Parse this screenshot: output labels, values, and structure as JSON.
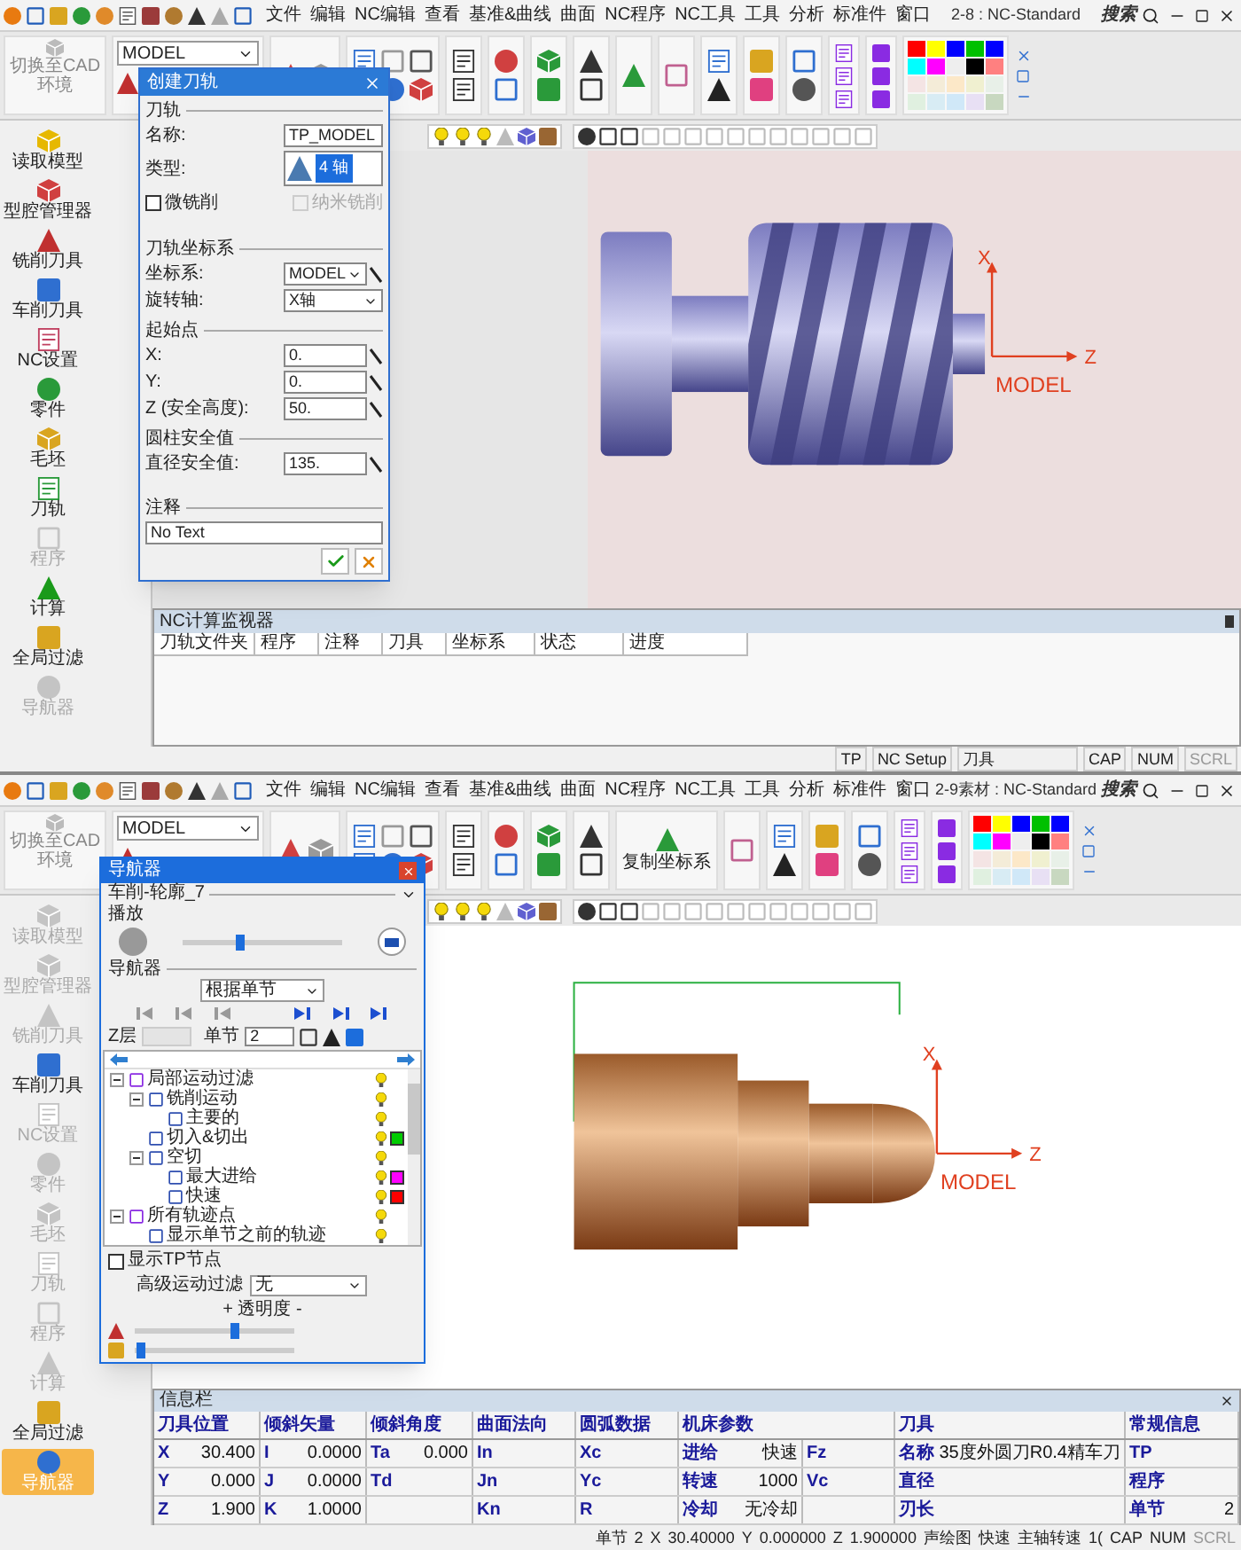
{
  "top_window": {
    "menu": [
      "文件",
      "编辑",
      "NC编辑",
      "查看",
      "基准&曲线",
      "曲面",
      "NC程序",
      "NC工具",
      "工具",
      "分析",
      "标准件",
      "窗口"
    ],
    "title": "2-8 : NC-Standard",
    "search": "搜索",
    "ribbon": {
      "cad_button": "切换至CAD环境",
      "model_select": "MODEL"
    },
    "sidebar": [
      {
        "label": "读取模型",
        "disabled": false,
        "selected": false
      },
      {
        "label": "型腔管理器",
        "disabled": false,
        "selected": false
      },
      {
        "label": "铣削刀具",
        "disabled": false,
        "selected": false
      },
      {
        "label": "车削刀具",
        "disabled": false,
        "selected": false
      },
      {
        "label": "NC设置",
        "disabled": false,
        "selected": false
      },
      {
        "label": "零件",
        "disabled": false,
        "selected": false
      },
      {
        "label": "毛坯",
        "disabled": false,
        "selected": false
      },
      {
        "label": "刀轨",
        "disabled": false,
        "selected": false
      },
      {
        "label": "程序",
        "disabled": true,
        "selected": false
      },
      {
        "label": "计算",
        "disabled": false,
        "selected": false
      },
      {
        "label": "全局过滤",
        "disabled": false,
        "selected": false
      },
      {
        "label": "导航器",
        "disabled": true,
        "selected": false
      }
    ],
    "dialog": {
      "title": "创建刀轨",
      "group": "刀轨",
      "name_label": "名称:",
      "name_value": "TP_MODEL",
      "type_label": "类型:",
      "type_value": "4 轴",
      "checkboxes": [
        {
          "label": "微铣削",
          "checked": false,
          "disabled": false
        },
        {
          "label": "纳米铣削",
          "checked": false,
          "disabled": true
        }
      ],
      "coord_group": "刀轨坐标系",
      "coord_label": "坐标系:",
      "coord_value": "MODEL",
      "axis_label": "旋转轴:",
      "axis_value": "X轴",
      "start_group": "起始点",
      "start_fields": [
        {
          "label": "X:",
          "value": "0."
        },
        {
          "label": "Y:",
          "value": "0."
        },
        {
          "label": "Z (安全高度):",
          "value": "50."
        }
      ],
      "cyl_group": "圆柱安全值",
      "dia_label": "直径安全值:",
      "dia_value": "135.",
      "comment_group": "注释",
      "comment_value": "No Text"
    },
    "viewport": {
      "axis_x": "X",
      "axis_z": "Z",
      "origin": "MODEL"
    },
    "monitor": {
      "title": "NC计算监视器",
      "columns": [
        "刀轨文件夹",
        "程序",
        "注释",
        "刀具",
        "坐标系",
        "状态",
        "进度"
      ]
    },
    "status_bar": [
      "TP",
      "NC Setup",
      "刀具",
      "CAP",
      "NUM",
      "SCRL"
    ]
  },
  "bottom_window": {
    "menu": [
      "文件",
      "编辑",
      "NC编辑",
      "查看",
      "基准&曲线",
      "曲面",
      "NC程序",
      "NC工具",
      "工具",
      "分析",
      "标准件",
      "窗口"
    ],
    "title": "2-9素材 : NC-Standard",
    "search": "搜索",
    "ribbon": {
      "cad_button": "切换至CAD环境",
      "model_select": "MODEL",
      "coord_label": "复制坐标系"
    },
    "sidebar": [
      {
        "label": "读取模型",
        "disabled": true,
        "selected": false
      },
      {
        "label": "型腔管理器",
        "disabled": true,
        "selected": false
      },
      {
        "label": "铣削刀具",
        "disabled": true,
        "selected": false
      },
      {
        "label": "车削刀具",
        "disabled": false,
        "selected": false
      },
      {
        "label": "NC设置",
        "disabled": true,
        "selected": false
      },
      {
        "label": "零件",
        "disabled": true,
        "selected": false
      },
      {
        "label": "毛坯",
        "disabled": true,
        "selected": false
      },
      {
        "label": "刀轨",
        "disabled": true,
        "selected": false
      },
      {
        "label": "程序",
        "disabled": true,
        "selected": false
      },
      {
        "label": "计算",
        "disabled": true,
        "selected": false
      },
      {
        "label": "全局过滤",
        "disabled": false,
        "selected": false
      },
      {
        "label": "导航器",
        "disabled": false,
        "selected": true
      }
    ],
    "navigator": {
      "title": "导航器",
      "procedure": "车削-轮廓_7",
      "play_group": "播放",
      "play_slider": {
        "level": 0.35
      },
      "nav_group": "导航器",
      "mode_select": "根据单节",
      "z_label": "Z层",
      "step_label": "单节",
      "step_value": "2",
      "tree": [
        {
          "label": "局部运动过滤",
          "expanded": true,
          "children": [
            {
              "label": "铣削运动",
              "expanded": true,
              "children": [
                {
                  "label": "主要的"
                }
              ]
            },
            {
              "label": "切入&切出",
              "color": "#00cc00"
            },
            {
              "label": "空切",
              "expanded": true,
              "children": [
                {
                  "label": "最大进给",
                  "color": "#ff00ff"
                },
                {
                  "label": "快速",
                  "color": "#ff0000"
                }
              ]
            }
          ]
        },
        {
          "label": "所有轨迹点",
          "expanded": true,
          "children": [
            {
              "label": "显示单节之前的轨迹"
            }
          ]
        }
      ],
      "tp_checkbox": {
        "label": "显示TP节点",
        "checked": false
      },
      "filter_label": "高级运动过滤",
      "filter_value": "无",
      "transparency": "+ 透明度 -",
      "transparency_slider": {
        "level": 0.62
      },
      "fill_slider": {
        "level": 0.03
      }
    },
    "viewport": {
      "axis_x": "X",
      "axis_z": "Z",
      "origin": "MODEL"
    },
    "info": {
      "title": "信息栏",
      "headers": [
        "刀具位置",
        "倾斜矢量",
        "倾斜角度",
        "曲面法向",
        "圆弧数据",
        "机床参数",
        "刀具",
        "常规信息"
      ],
      "rows": [
        [
          {
            "label": "X",
            "value": "30.400"
          },
          {
            "label": "I",
            "value": "0.0000"
          },
          {
            "label": "Ta",
            "value": "0.000"
          },
          {
            "label": "In"
          },
          {
            "label": "Xc"
          },
          {
            "label": "进给",
            "value": "快速"
          },
          {
            "label": "Fz"
          },
          {
            "label": "名称",
            "value": "35度外圆刀R0.4精车刀"
          },
          {
            "label": "TP"
          }
        ],
        [
          {
            "label": "Y",
            "value": "0.000"
          },
          {
            "label": "J",
            "value": "0.0000"
          },
          {
            "label": "Td"
          },
          {
            "label": "Jn"
          },
          {
            "label": "Yc"
          },
          {
            "label": "转速",
            "value": "1000"
          },
          {
            "label": "Vc"
          },
          {
            "label": "直径"
          },
          {
            "label": "程序"
          }
        ],
        [
          {
            "label": "Z",
            "value": "1.900"
          },
          {
            "label": "K",
            "value": "1.0000"
          },
          {},
          {
            "label": "Kn"
          },
          {
            "label": "R"
          },
          {
            "label": "冷却",
            "value": "无冷却"
          },
          {},
          {
            "label": "刃长"
          },
          {
            "label": "单节",
            "value": "2"
          }
        ]
      ]
    },
    "status_bar": [
      "单节",
      "2",
      "X",
      "30.40000",
      "Y",
      "0.000000",
      "Z",
      "1.900000",
      "声绘图",
      "快速",
      "主轴转速",
      "1(",
      "CAP",
      "NUM",
      "SCRL"
    ]
  }
}
